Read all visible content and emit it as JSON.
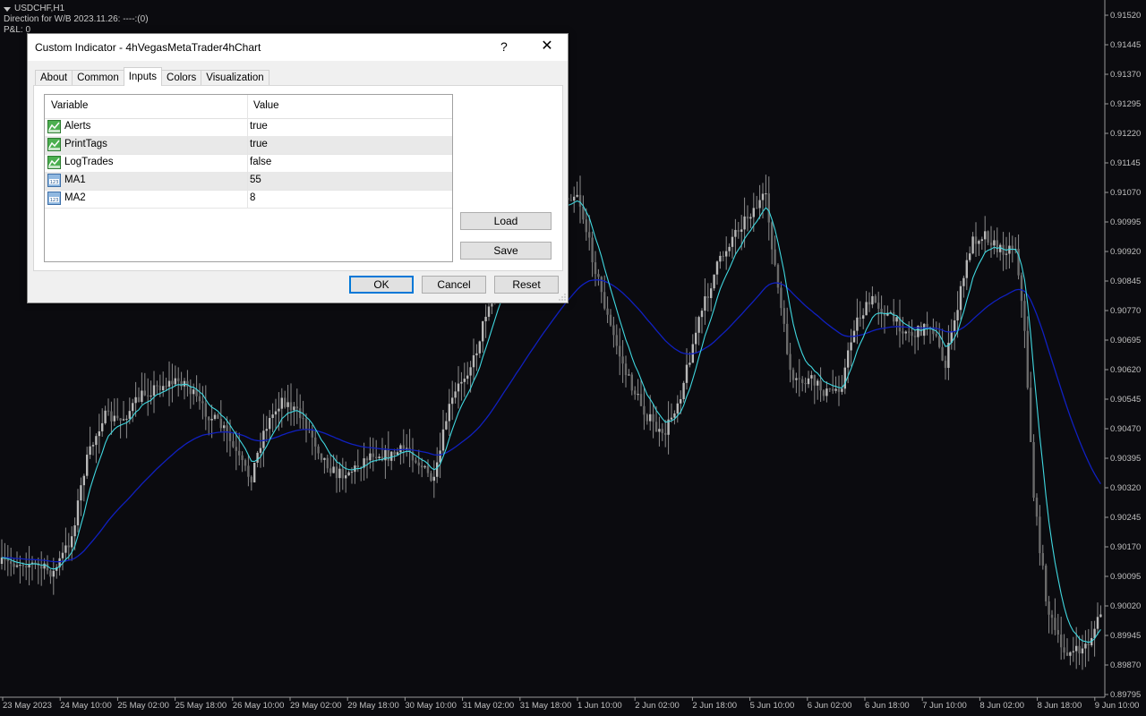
{
  "chart": {
    "symbol": "USDCHF,H1",
    "direction": "Direction for W/B 2023.11.26: ----:(0)",
    "pnl": "P&L: 0",
    "price_labels": [
      "0.91520",
      "0.91445",
      "0.91370",
      "0.91295",
      "0.91220",
      "0.91145",
      "0.91070",
      "0.90995",
      "0.90920",
      "0.90845",
      "0.90770",
      "0.90695",
      "0.90620",
      "0.90545",
      "0.90470",
      "0.90395",
      "0.90320",
      "0.90245",
      "0.90170",
      "0.90095",
      "0.90020",
      "0.89945",
      "0.89870",
      "0.89795"
    ],
    "time_labels": [
      "23 May 2023",
      "24 May 10:00",
      "25 May 02:00",
      "25 May 18:00",
      "26 May 10:00",
      "29 May 02:00",
      "29 May 18:00",
      "30 May 10:00",
      "31 May 02:00",
      "31 May 18:00",
      "1 Jun 10:00",
      "2 Jun 02:00",
      "2 Jun 18:00",
      "5 Jun 10:00",
      "6 Jun 02:00",
      "6 Jun 18:00",
      "7 Jun 10:00",
      "8 Jun 02:00",
      "8 Jun 18:00",
      "9 Jun 10:00"
    ],
    "colors": {
      "background": "#0b0b0f",
      "candles": "#8c8c8c",
      "ma_fast": "#40d8e0",
      "ma_slow": "#1020c0",
      "axis_text": "#c0c0c0"
    }
  },
  "dialog": {
    "title": "Custom Indicator - 4hVegasMetaTrader4hChart",
    "help_label": "?",
    "close_label": "✕",
    "tabs": [
      {
        "label": "About"
      },
      {
        "label": "Common"
      },
      {
        "label": "Inputs"
      },
      {
        "label": "Colors"
      },
      {
        "label": "Visualization"
      }
    ],
    "active_tab": "Inputs",
    "grid": {
      "headers": {
        "variable": "Variable",
        "value": "Value"
      },
      "rows": [
        {
          "variable": "Alerts",
          "value": "true",
          "icon": "bool-icon"
        },
        {
          "variable": "PrintTags",
          "value": "true",
          "icon": "bool-icon"
        },
        {
          "variable": "LogTrades",
          "value": "false",
          "icon": "bool-icon"
        },
        {
          "variable": "MA1",
          "value": "55",
          "icon": "integer-icon"
        },
        {
          "variable": "MA2",
          "value": "8",
          "icon": "integer-icon"
        }
      ]
    },
    "buttons": {
      "load": "Load",
      "save": "Save",
      "ok": "OK",
      "cancel": "Cancel",
      "reset": "Reset"
    }
  }
}
